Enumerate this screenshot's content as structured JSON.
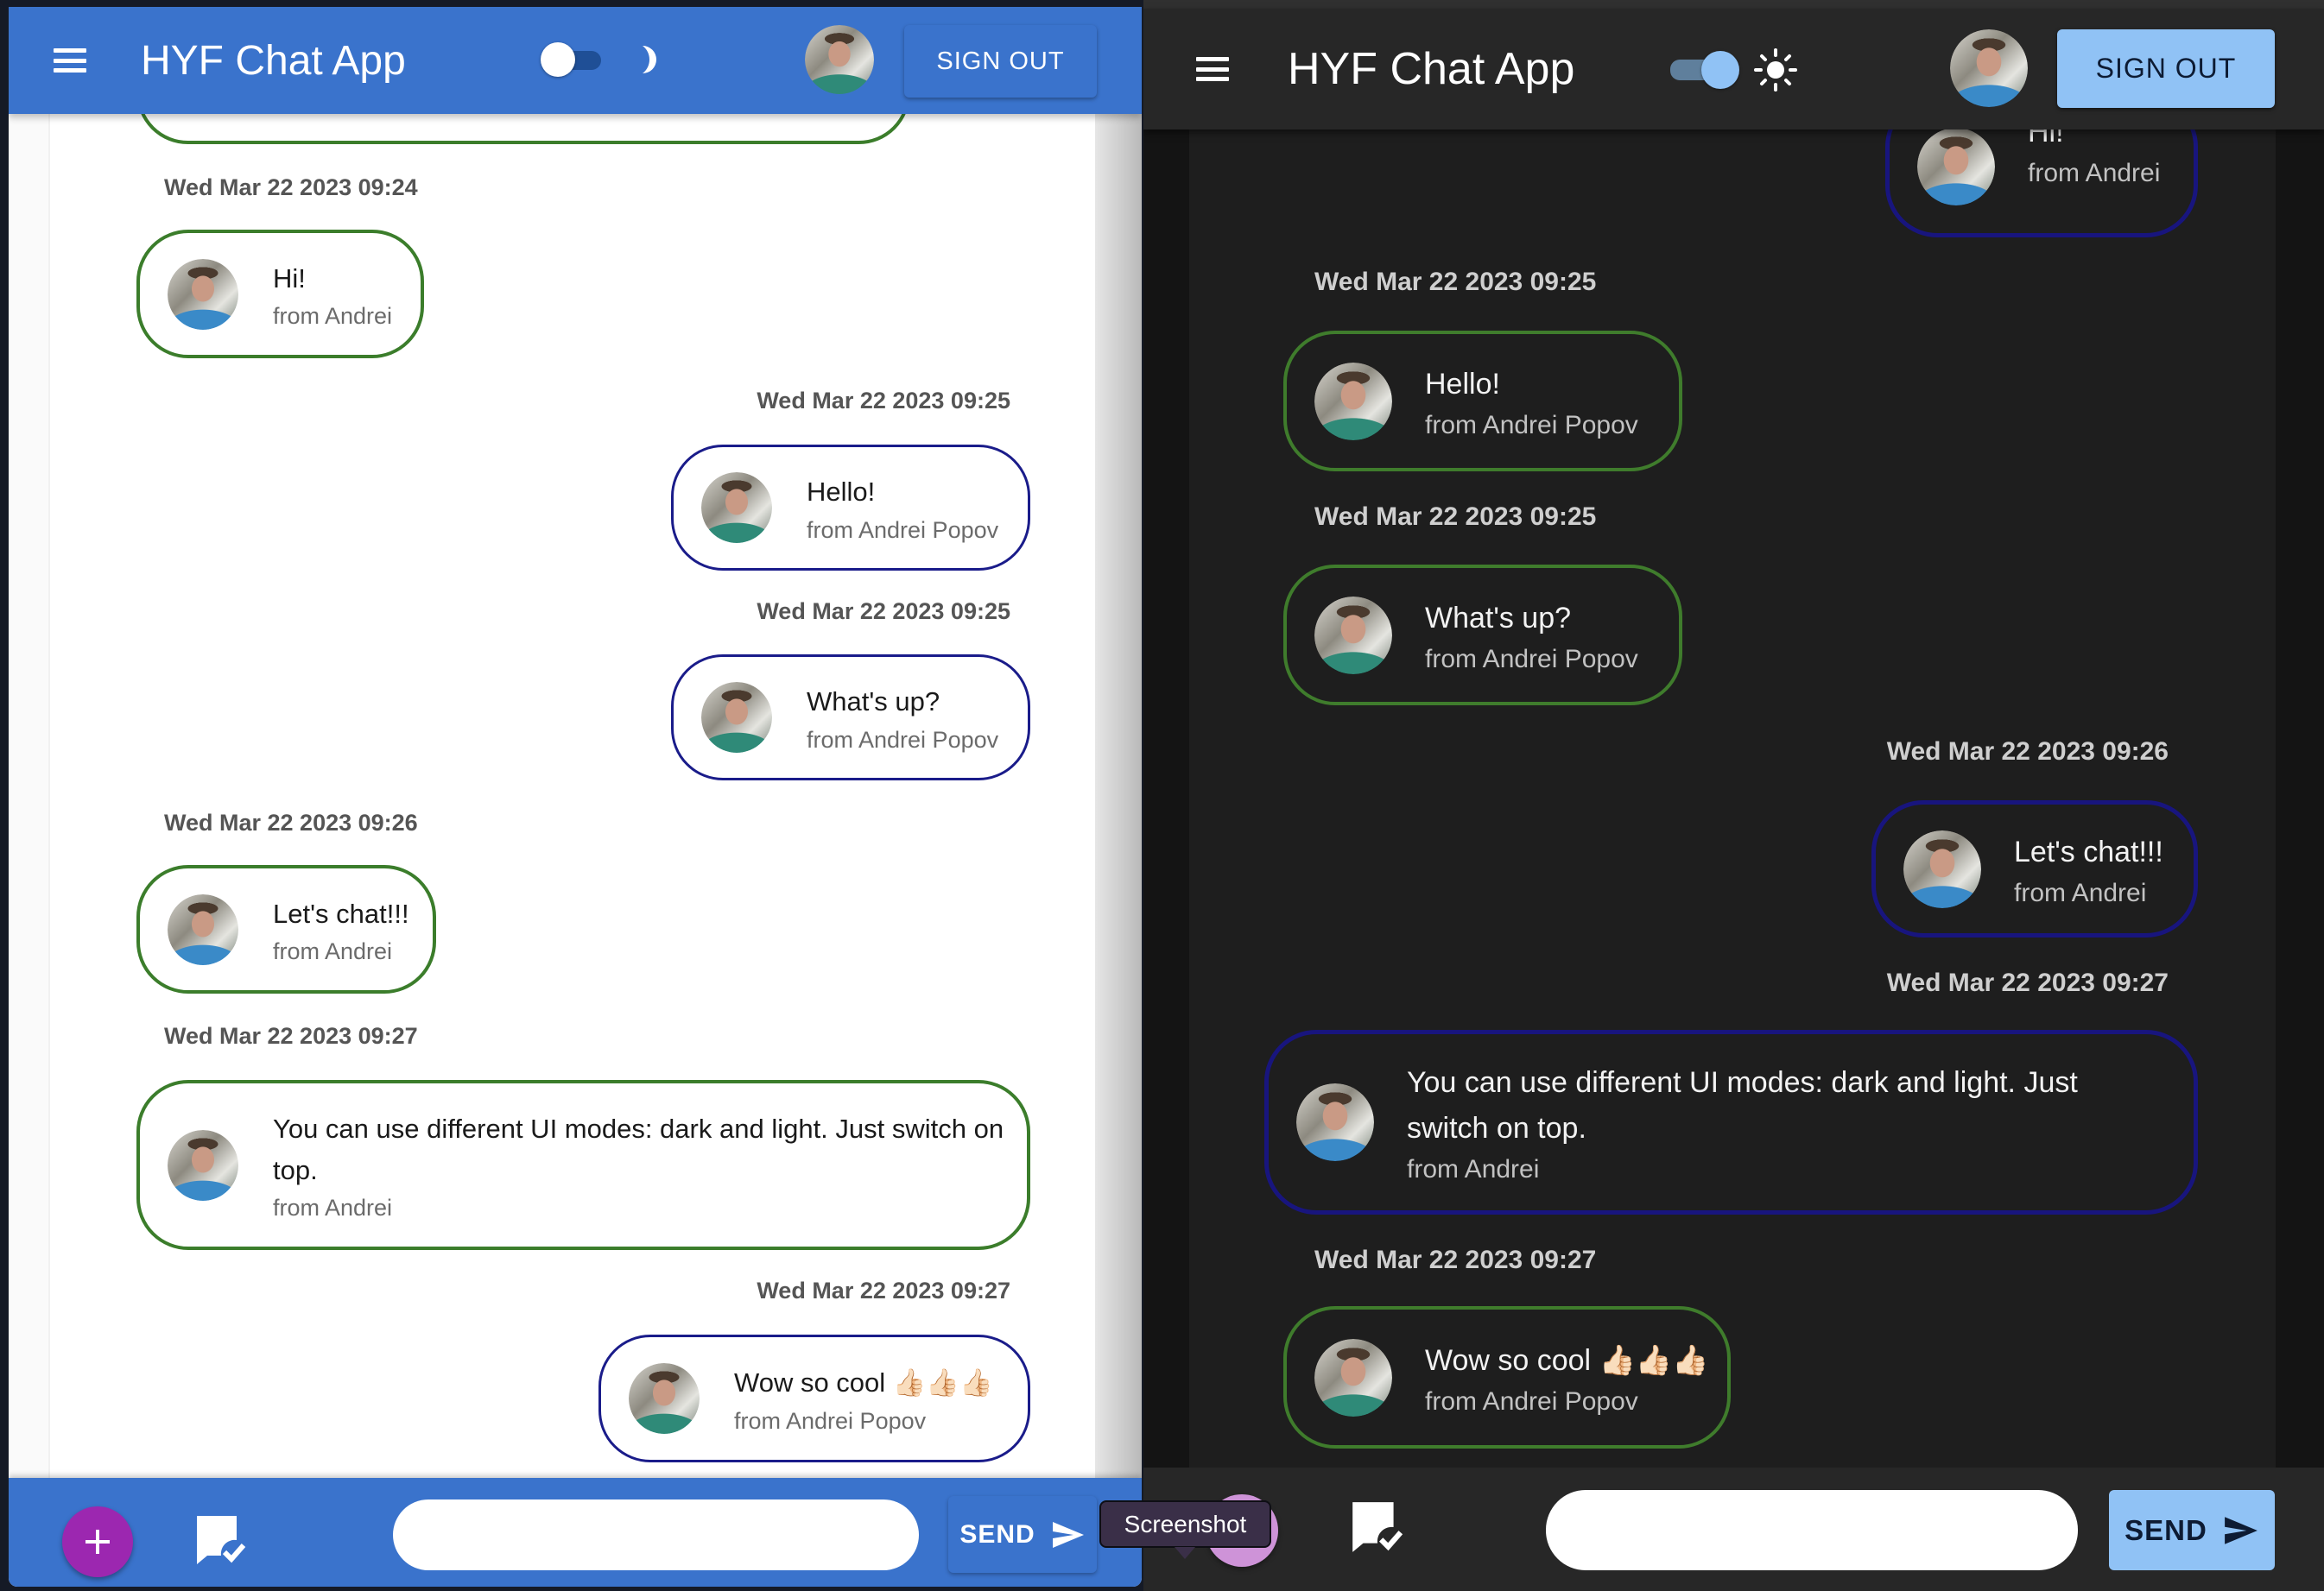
{
  "app": {
    "title": "HYF Chat App",
    "sign_out_label": "SIGN OUT",
    "send_label": "SEND"
  },
  "colors": {
    "light_primary": "#3a73cc",
    "dark_primary": "#90c2f5",
    "own_message_border": "#3b7d2b",
    "other_message_border": "#1a1c8a",
    "fab_light": "#9c27b0",
    "fab_dark": "#ce93d8"
  },
  "light_mode": {
    "theme_toggle": {
      "dark_mode_on": false,
      "icon": "moon-icon"
    },
    "messages": [
      {
        "timestamp": "",
        "text": "",
        "from": "",
        "align": "left",
        "partial": true
      },
      {
        "timestamp": "Wed Mar 22 2023 09:24",
        "text": "Hi!",
        "from": "from Andrei",
        "align": "left"
      },
      {
        "timestamp": "Wed Mar 22 2023 09:25",
        "text": "Hello!",
        "from": "from Andrei Popov",
        "align": "right"
      },
      {
        "timestamp": "Wed Mar 22 2023 09:25",
        "text": "What's up?",
        "from": "from Andrei Popov",
        "align": "right"
      },
      {
        "timestamp": "Wed Mar 22 2023 09:26",
        "text": "Let's chat!!!",
        "from": "from Andrei",
        "align": "left"
      },
      {
        "timestamp": "Wed Mar 22 2023 09:27",
        "text": "You can use different UI modes: dark and light. Just switch on top.",
        "from": "from Andrei",
        "align": "left"
      },
      {
        "timestamp": "Wed Mar 22 2023 09:27",
        "text": "Wow so cool 👍🏻👍🏻👍🏻",
        "from": "from Andrei Popov",
        "align": "right"
      }
    ],
    "input": {
      "value": "",
      "placeholder": ""
    }
  },
  "dark_mode": {
    "theme_toggle": {
      "dark_mode_on": true,
      "icon": "sun-icon"
    },
    "messages": [
      {
        "timestamp": "",
        "text": "Hi!",
        "from": "from Andrei",
        "align": "right",
        "partial": true
      },
      {
        "timestamp": "Wed Mar 22 2023 09:25",
        "text": "Hello!",
        "from": "from Andrei Popov",
        "align": "left"
      },
      {
        "timestamp": "Wed Mar 22 2023 09:25",
        "text": "What's up?",
        "from": "from Andrei Popov",
        "align": "left"
      },
      {
        "timestamp": "Wed Mar 22 2023 09:26",
        "text": "Let's chat!!!",
        "from": "from Andrei",
        "align": "right"
      },
      {
        "timestamp": "Wed Mar 22 2023 09:27",
        "text": "You can use different UI modes: dark and light. Just switch on top.",
        "from": "from Andrei",
        "align": "right"
      },
      {
        "timestamp": "Wed Mar 22 2023 09:27",
        "text": "Wow so cool 👍🏻👍🏻👍🏻",
        "from": "from Andrei Popov",
        "align": "left"
      }
    ],
    "input": {
      "value": "",
      "placeholder": ""
    },
    "tooltip": "Screenshot"
  }
}
